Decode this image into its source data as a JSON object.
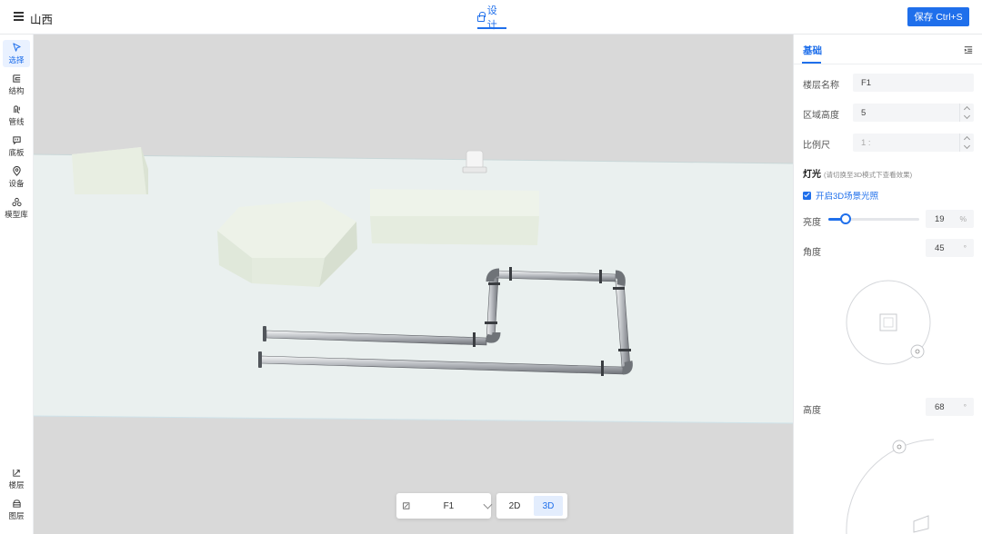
{
  "header": {
    "menu_icon": "menu-icon",
    "title": "山西",
    "design_tab_label": "设计",
    "save_button_label": "保存 Ctrl+S"
  },
  "sidebar": {
    "items": [
      {
        "label": "选择",
        "icon": "cursor-icon",
        "active": true
      },
      {
        "label": "结构",
        "icon": "structure-icon",
        "active": false
      },
      {
        "label": "管线",
        "icon": "pipeline-icon",
        "active": false
      },
      {
        "label": "底板",
        "icon": "floorplate-icon",
        "active": false
      },
      {
        "label": "设备",
        "icon": "device-icon",
        "active": false
      },
      {
        "label": "模型库",
        "icon": "model-library-icon",
        "active": false
      }
    ],
    "bottom_items": [
      {
        "label": "楼层",
        "icon": "floor-icon"
      },
      {
        "label": "图层",
        "icon": "layer-icon"
      }
    ]
  },
  "canvas": {
    "floor_selector_value": "F1",
    "view_modes": [
      "2D",
      "3D"
    ],
    "active_view_mode": "3D"
  },
  "panel": {
    "tab_label": "基础",
    "floor_name_label": "楼层名称",
    "floor_name_value": "F1",
    "region_height_label": "区域高度",
    "region_height_value": "5",
    "scale_label": "比例尺",
    "scale_value": "1 :",
    "light_section_title": "灯光",
    "light_section_hint": "(请切换至3D模式下查看效果)",
    "enable_light_label": "开启3D场景光照",
    "enable_light_checked": true,
    "brightness_label": "亮度",
    "brightness_value": "19",
    "brightness_unit": "%",
    "brightness_level": 0.19,
    "angle_label": "角度",
    "angle_value": "45",
    "angle_unit": "°",
    "height_label": "高度",
    "height_value": "68",
    "height_unit": "°"
  },
  "colors": {
    "accent": "#1f6feb",
    "canvas_bg": "#d9d9d9",
    "floor_plate": "#eaf0ef",
    "block_fill": "#e6ecde"
  }
}
